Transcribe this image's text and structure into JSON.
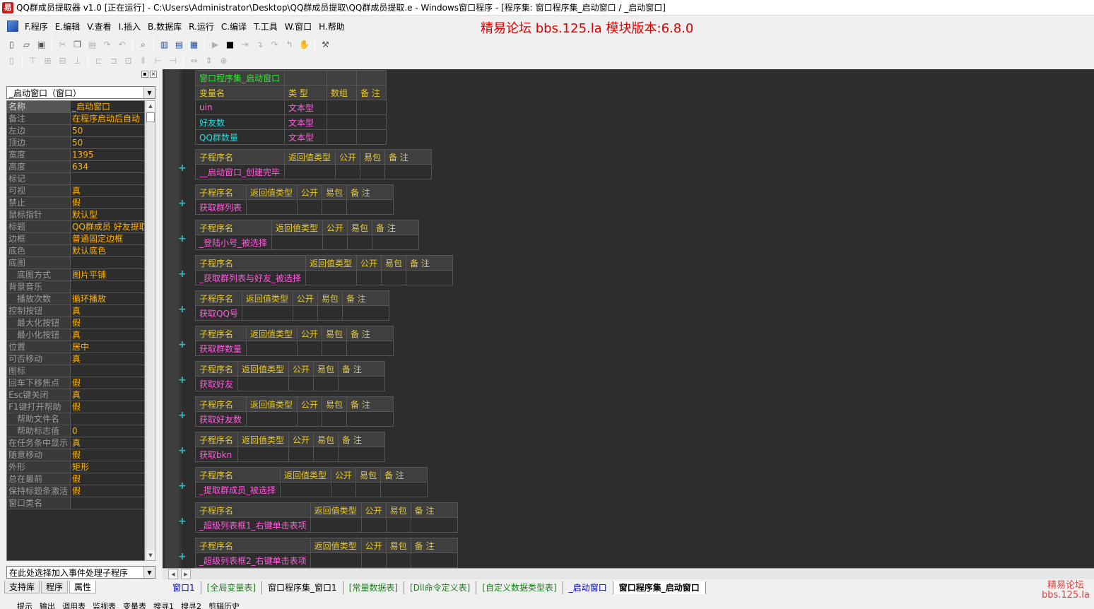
{
  "window": {
    "title": "QQ群成员提取器 v1.0   [正在运行] - C:\\Users\\Administrator\\Desktop\\QQ群成员提取\\QQ群成员提取.e - Windows窗口程序 - [程序集: 窗口程序集_启动窗口 / _启动窗口]"
  },
  "menu": {
    "items": [
      "F.程序",
      "E.编辑",
      "V.查看",
      "I.插入",
      "B.数据库",
      "R.运行",
      "C.编译",
      "T.工具",
      "W.窗口",
      "H.帮助"
    ],
    "brand": "精易论坛 bbs.125.la 模块版本:6.8.0"
  },
  "left_panel": {
    "object_combo": "_启动窗口（窗口）",
    "event_combo": "在此处选择加入事件处理子程序",
    "properties": [
      {
        "name": "名称",
        "value": "_启动窗口",
        "indent": false
      },
      {
        "name": "备注",
        "value": "在程序启动后自动",
        "indent": false
      },
      {
        "name": "左边",
        "value": "50",
        "indent": false
      },
      {
        "name": "顶边",
        "value": "50",
        "indent": false
      },
      {
        "name": "宽度",
        "value": "1395",
        "indent": false
      },
      {
        "name": "高度",
        "value": "634",
        "indent": false
      },
      {
        "name": "标记",
        "value": "",
        "indent": false
      },
      {
        "name": "可视",
        "value": "真",
        "indent": false
      },
      {
        "name": "禁止",
        "value": "假",
        "indent": false
      },
      {
        "name": "鼠标指针",
        "value": "默认型",
        "indent": false
      },
      {
        "name": "标题",
        "value": "QQ群成员 好友提取",
        "indent": false
      },
      {
        "name": "边框",
        "value": "普通固定边框",
        "indent": false
      },
      {
        "name": "底色",
        "value": "默认底色",
        "indent": false
      },
      {
        "name": "底图",
        "value": "",
        "indent": false
      },
      {
        "name": "底图方式",
        "value": "图片平铺",
        "indent": true
      },
      {
        "name": "背景音乐",
        "value": "",
        "indent": false
      },
      {
        "name": "播放次数",
        "value": "循环播放",
        "indent": true
      },
      {
        "name": "控制按钮",
        "value": "真",
        "indent": false
      },
      {
        "name": "最大化按钮",
        "value": "假",
        "indent": true
      },
      {
        "name": "最小化按钮",
        "value": "真",
        "indent": true
      },
      {
        "name": "位置",
        "value": "居中",
        "indent": false
      },
      {
        "name": "可否移动",
        "value": "真",
        "indent": false
      },
      {
        "name": "图标",
        "value": "",
        "indent": false
      },
      {
        "name": "回车下移焦点",
        "value": "假",
        "indent": false
      },
      {
        "name": "Esc键关闭",
        "value": "真",
        "indent": false
      },
      {
        "name": "F1键打开帮助",
        "value": "假",
        "indent": false
      },
      {
        "name": "帮助文件名",
        "value": "",
        "indent": true
      },
      {
        "name": "帮助标志值",
        "value": "0",
        "indent": true
      },
      {
        "name": "在任务条中显示",
        "value": "真",
        "indent": false
      },
      {
        "name": "随意移动",
        "value": "假",
        "indent": false
      },
      {
        "name": "外形",
        "value": "矩形",
        "indent": false
      },
      {
        "name": "总在最前",
        "value": "假",
        "indent": false
      },
      {
        "name": "保持标题条激活",
        "value": "假",
        "indent": false
      },
      {
        "name": "窗口类名",
        "value": "",
        "indent": false
      }
    ],
    "tabs": [
      "支持库",
      "程序",
      "属性"
    ]
  },
  "editor": {
    "class_table": {
      "class_name": "窗口程序集_启动窗口",
      "headers": [
        "变量名",
        "类 型",
        "数组",
        "备 注"
      ],
      "rows": [
        {
          "name": "uin",
          "type": "文本型"
        },
        {
          "name": "好友数",
          "type": "文本型"
        },
        {
          "name": "QQ群数量",
          "type": "文本型"
        }
      ]
    },
    "sub_headers": [
      "子程序名",
      "返回值类型",
      "公开",
      "易包",
      "备 注"
    ],
    "subs": [
      "__启动窗口_创建完毕",
      "获取群列表",
      "_登陆小号_被选择",
      "_获取群列表与好友_被选择",
      "获取QQ号",
      "获取群数量",
      "获取好友",
      "获取好友数",
      "获取bkn",
      "_提取群成员_被选择",
      "_超级列表框1_右键单击表项",
      "_超级列表框2_右键单击表项"
    ]
  },
  "doc_tabs": [
    "窗口1",
    "[全局变量表]",
    "窗口程序集_窗口1",
    "[常量数据表]",
    "[Dll命令定义表]",
    "[自定义数据类型表]",
    "_启动窗口",
    "窗口程序集_启动窗口"
  ],
  "watermark": {
    "line1": "精易论坛",
    "line2": "bbs.125.la"
  },
  "status_items": [
    "提示",
    "输出",
    "调用表",
    "监视表",
    "变量表",
    "搜寻1",
    "搜寻2",
    "剪辑历史"
  ]
}
